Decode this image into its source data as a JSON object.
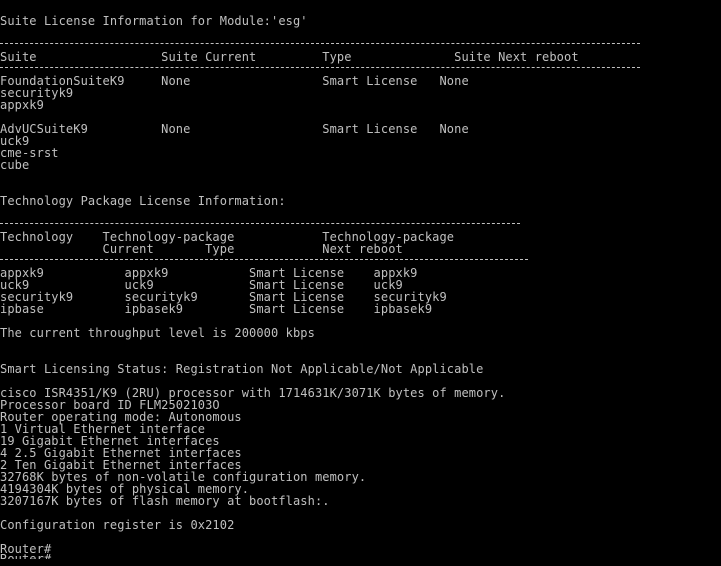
{
  "terminal": {
    "header": "Suite License Information for Module:'esg'",
    "suite_table_header": "Suite                 Suite Current         Type              Suite Next reboot",
    "suite_rows": [
      "FoundationSuiteK9     None                  Smart License   None",
      "securityk9",
      "appxk9",
      "",
      "AdvUCSuiteK9          None                  Smart License   None",
      "uck9",
      "cme-srst",
      "cube"
    ],
    "tech_header": "Technology Package License Information:",
    "tech_table_header_1": "Technology    Technology-package            Technology-package",
    "tech_table_header_2": "              Current       Type            Next reboot",
    "tech_rows": [
      "appxk9           appxk9           Smart License    appxk9",
      "uck9             uck9             Smart License    uck9",
      "securityk9       securityk9       Smart License    securityk9",
      "ipbase           ipbasek9         Smart License    ipbasek9"
    ],
    "throughput": "The current throughput level is 200000 kbps",
    "smart_status": "Smart Licensing Status: Registration Not Applicable/Not Applicable",
    "hardware_lines": [
      "cisco ISR4351/K9 (2RU) processor with 1714631K/3071K bytes of memory.",
      "Processor board ID FLM2502103O",
      "Router operating mode: Autonomous",
      "1 Virtual Ethernet interface",
      "19 Gigabit Ethernet interfaces",
      "4 2.5 Gigabit Ethernet interfaces",
      "2 Ten Gigabit Ethernet interfaces",
      "32768K bytes of non-volatile configuration memory.",
      "4194304K bytes of physical memory.",
      "3207167K bytes of flash memory at bootflash:."
    ],
    "config_register": "Configuration register is 0x2102",
    "prompt": "Router#",
    "partial_prompt": "Router#"
  }
}
